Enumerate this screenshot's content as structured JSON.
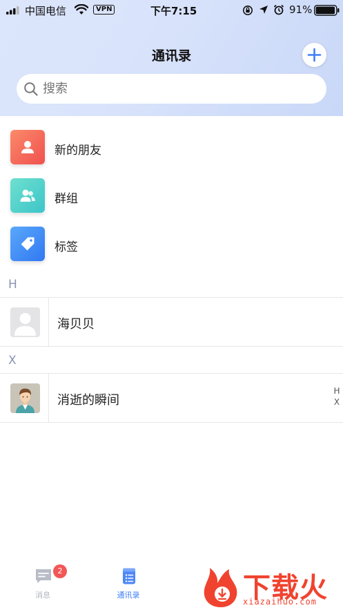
{
  "status_bar": {
    "carrier": "中国电信",
    "vpn": "VPN",
    "time": "下午7:15",
    "battery_percent": "91%",
    "icons": [
      "signal-icon",
      "wifi-icon",
      "rotation-lock-icon",
      "location-icon",
      "alarm-icon",
      "battery-icon"
    ]
  },
  "header": {
    "title": "通讯录",
    "add_icon": "plus-icon"
  },
  "search": {
    "placeholder": "搜索",
    "icon": "search-icon"
  },
  "functions": [
    {
      "label": "新的朋友",
      "icon": "person-icon",
      "color": "#f25c54"
    },
    {
      "label": "群组",
      "icon": "group-icon",
      "color": "#4fd1c5"
    },
    {
      "label": "标签",
      "icon": "tag-icon",
      "color": "#3e8ef7"
    }
  ],
  "contacts": [
    {
      "section": "H",
      "name": "海贝贝",
      "avatar": "default-avatar"
    },
    {
      "section": "X",
      "name": "消逝的瞬间",
      "avatar": "cartoon-boy-avatar"
    }
  ],
  "index_bar": [
    "H",
    "X"
  ],
  "tabbar": {
    "tabs": [
      {
        "label": "消息",
        "icon": "message-icon",
        "badge": "2",
        "active": false
      },
      {
        "label": "通讯录",
        "icon": "contacts-icon",
        "active": true
      }
    ],
    "active_color": "#3e7ef7",
    "inactive_color": "#b0b4bf"
  },
  "watermark": {
    "text": "下载火",
    "url": "xiazaihuo.com"
  }
}
